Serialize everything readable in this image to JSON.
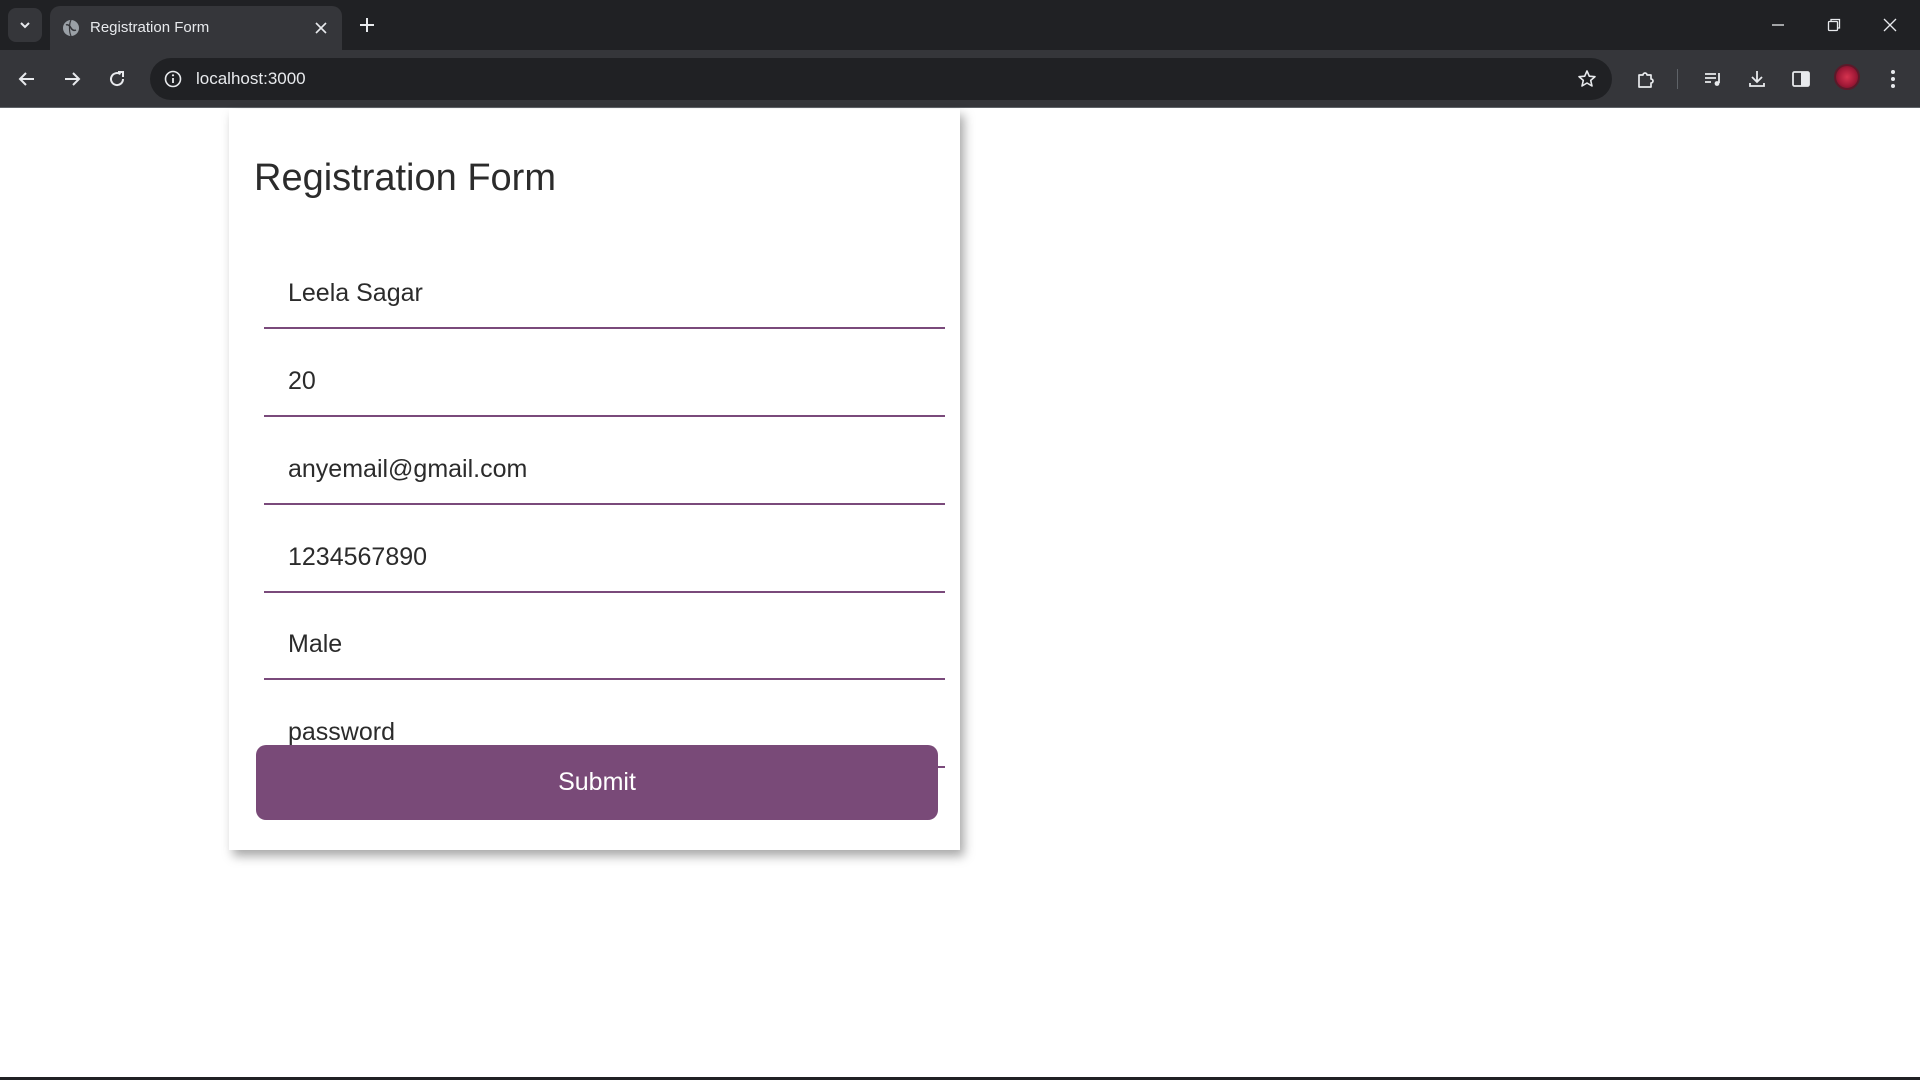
{
  "browser": {
    "tab_title": "Registration Form",
    "url": "localhost:3000",
    "icons": {
      "tab_search": "chevron-down-icon",
      "favicon": "globe-icon",
      "tab_close": "close-icon",
      "new_tab": "plus-icon",
      "back": "arrow-left-icon",
      "forward": "arrow-right-icon",
      "reload": "reload-icon",
      "site_info": "info-icon",
      "bookmark": "star-icon",
      "extensions": "puzzle-icon",
      "media": "media-queue-icon",
      "downloads": "download-icon",
      "side_panel": "side-panel-icon",
      "menu": "kebab-menu-icon",
      "minimize": "minimize-icon",
      "restore": "restore-icon",
      "close_window": "close-icon"
    }
  },
  "form": {
    "title": "Registration Form",
    "fields": {
      "name": "Leela Sagar",
      "age": "20",
      "email": "anyemail@gmail.com",
      "phone": "1234567890",
      "gender": "Male",
      "password": "password"
    },
    "submit_label": "Submit"
  },
  "colors": {
    "accent": "#794a78",
    "chrome_dark": "#202124",
    "chrome_toolbar": "#35363a"
  }
}
